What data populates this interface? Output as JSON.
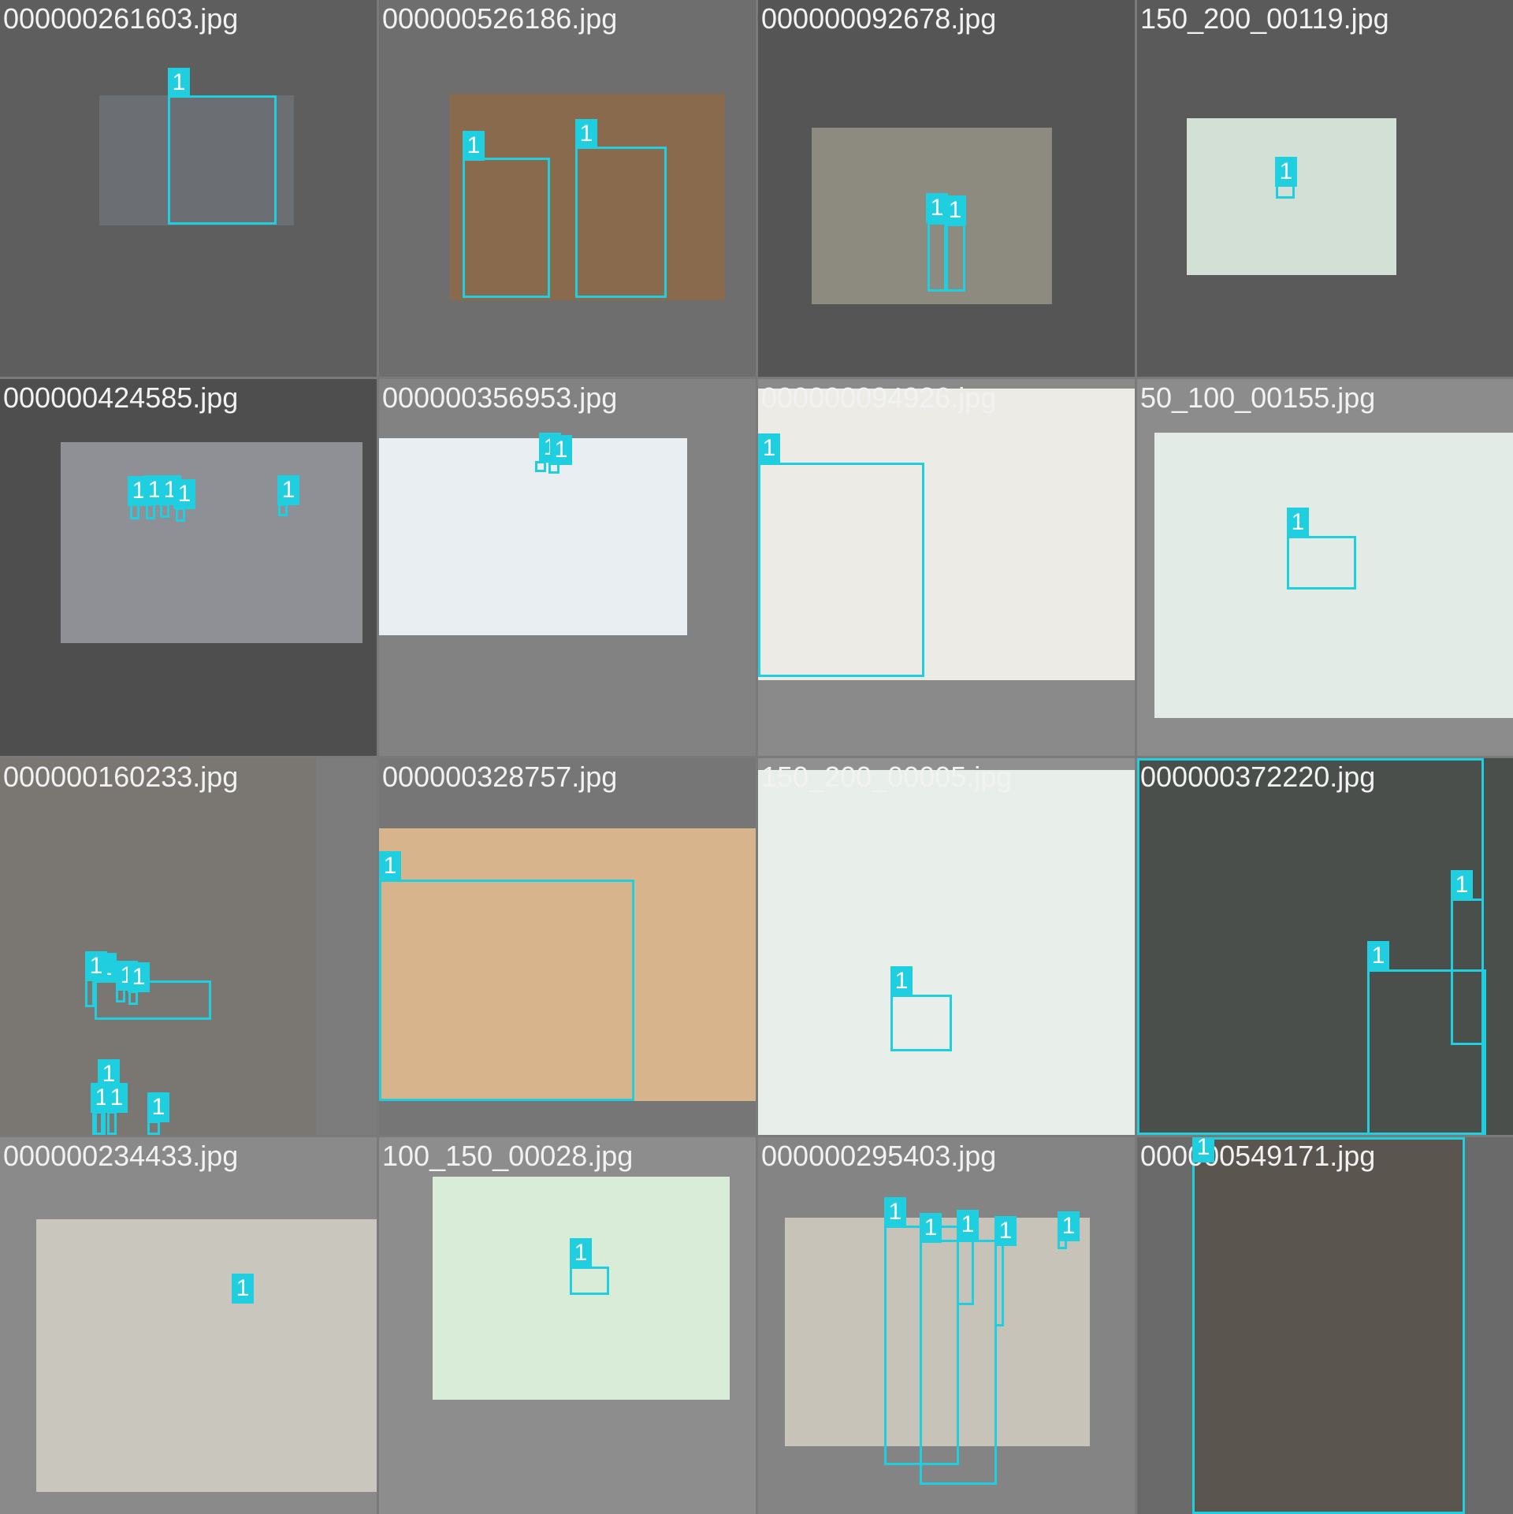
{
  "colors": {
    "box": "#1fcfe0",
    "label_text": "#ffffff",
    "filename_text": "#f2f2f2"
  },
  "tiles": [
    {
      "filename": "000000261603.jpg",
      "bg": "#5e5e5e",
      "photo_color": "#6b6f74",
      "boxes": [
        {
          "label": "1"
        }
      ]
    },
    {
      "filename": "000000526186.jpg",
      "bg": "#6e6e6e",
      "photo_color": "#8a6a4c",
      "boxes": [
        {
          "label": "1"
        },
        {
          "label": "1"
        }
      ]
    },
    {
      "filename": "000000092678.jpg",
      "bg": "#555555",
      "photo_color": "#8d8a80",
      "boxes": [
        {
          "label": "1"
        },
        {
          "label": "1"
        }
      ]
    },
    {
      "filename": "150_200_00119.jpg",
      "bg": "#5a5a5a",
      "photo_color": "#d2e0d6",
      "boxes": [
        {
          "label": "1"
        }
      ]
    },
    {
      "filename": "000000424585.jpg",
      "bg": "#4e4e4e",
      "photo_color": "#8e9096",
      "boxes": [
        {
          "label": "1"
        },
        {
          "label": "1"
        },
        {
          "label": "1"
        },
        {
          "label": "1"
        },
        {
          "label": "1"
        }
      ]
    },
    {
      "filename": "000000356953.jpg",
      "bg": "#828282",
      "photo_color": "#e9eef2",
      "boxes": [
        {
          "label": "1"
        },
        {
          "label": "1"
        }
      ]
    },
    {
      "filename": "000000094926.jpg",
      "bg": "#8a8a8a",
      "photo_color": "#ecebe6",
      "boxes": [
        {
          "label": "1"
        }
      ]
    },
    {
      "filename": "50_100_00155.jpg",
      "bg": "#8c8c8c",
      "photo_color": "#e3ebe6",
      "boxes": [
        {
          "label": "1"
        }
      ]
    },
    {
      "filename": "000000160233.jpg",
      "bg": "#7c7c7c",
      "photo_color": "#7a7772",
      "boxes": [
        {
          "label": "1"
        },
        {
          "label": "1"
        },
        {
          "label": "1"
        },
        {
          "label": "1"
        },
        {
          "label": "1"
        },
        {
          "label": "1"
        },
        {
          "label": "1"
        },
        {
          "label": "1"
        }
      ]
    },
    {
      "filename": "000000328757.jpg",
      "bg": "#767676",
      "photo_color": "#d8b48c",
      "boxes": [
        {
          "label": "1"
        }
      ]
    },
    {
      "filename": "150_200_00005.jpg",
      "bg": "#909090",
      "photo_color": "#e8eeea",
      "boxes": [
        {
          "label": "1"
        }
      ]
    },
    {
      "filename": "000000372220.jpg",
      "bg": "#727272",
      "photo_color": "#4a4f4c",
      "boxes": [
        {
          "label": "1"
        },
        {
          "label": "1"
        },
        {
          "label": "1"
        }
      ]
    },
    {
      "filename": "000000234433.jpg",
      "bg": "#8a8a8a",
      "photo_color": "#c9c6bd",
      "boxes": [
        {
          "label": "1"
        }
      ]
    },
    {
      "filename": "100_150_00028.jpg",
      "bg": "#8d8d8d",
      "photo_color": "#d9ecd8",
      "boxes": [
        {
          "label": "1"
        }
      ]
    },
    {
      "filename": "000000295403.jpg",
      "bg": "#848484",
      "photo_color": "#c7c3b8",
      "boxes": [
        {
          "label": "1"
        },
        {
          "label": "1"
        },
        {
          "label": "1"
        },
        {
          "label": "1"
        },
        {
          "label": "1"
        }
      ]
    },
    {
      "filename": "000000549171.jpg",
      "bg": "#6a6a6a",
      "photo_color": "#5a554f",
      "boxes": [
        {
          "label": "1"
        }
      ]
    }
  ]
}
